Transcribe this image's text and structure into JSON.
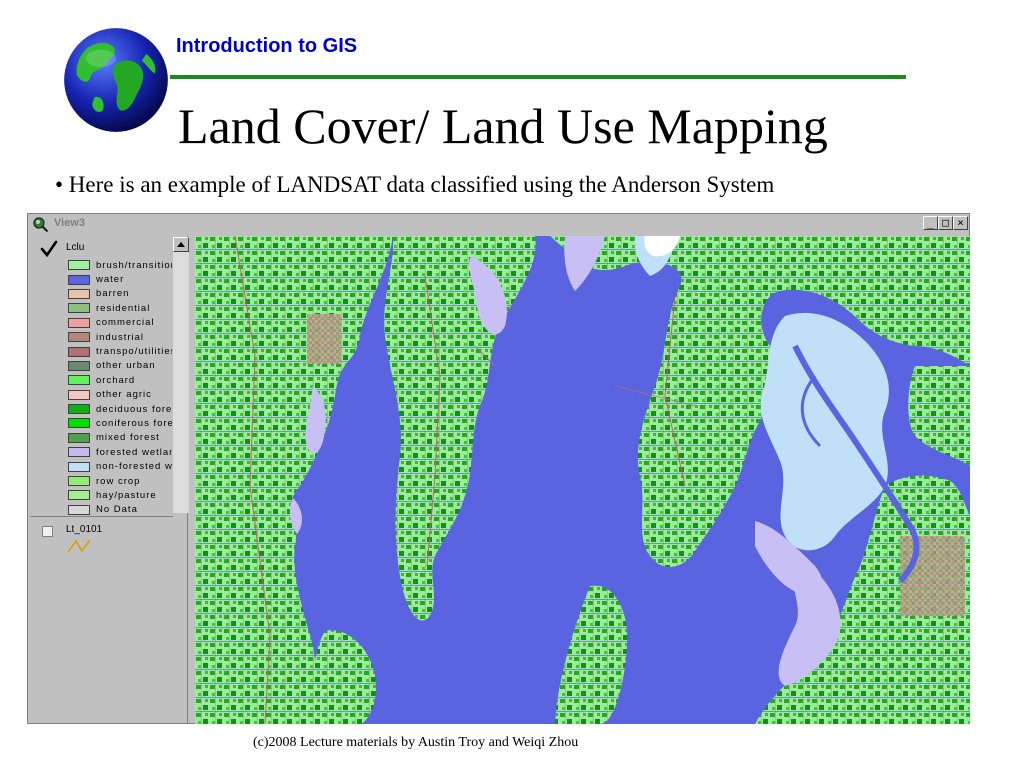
{
  "slide": {
    "course": "Introduction to GIS",
    "title": "Land Cover/ Land Use Mapping",
    "bullet": "• Here is an example of LANDSAT data classified using the Anderson System",
    "footer": "(c)2008 Lecture materials by Austin Troy and Weiqi Zhou"
  },
  "window": {
    "title": "View3",
    "buttons": {
      "minimize": "_",
      "maximize": "□",
      "close": "×"
    }
  },
  "toc": {
    "theme1": {
      "name": "Lclu",
      "items": [
        {
          "label": "brush/transitional",
          "color": "#a0f0a0"
        },
        {
          "label": "water",
          "color": "#5a63e0"
        },
        {
          "label": "barren",
          "color": "#e8c3ab"
        },
        {
          "label": "residential",
          "color": "#8fbf7f"
        },
        {
          "label": "commercial",
          "color": "#f0a0a0"
        },
        {
          "label": "industrial",
          "color": "#b08878"
        },
        {
          "label": "transpo/utilities",
          "color": "#b07070"
        },
        {
          "label": "other urban",
          "color": "#6a8a70"
        },
        {
          "label": "orchard",
          "color": "#60f060"
        },
        {
          "label": "other agric",
          "color": "#f4c8c0"
        },
        {
          "label": "deciduous forest",
          "color": "#10b010"
        },
        {
          "label": "coniferous forest",
          "color": "#00e000"
        },
        {
          "label": "mixed forest",
          "color": "#50a050"
        },
        {
          "label": "forested wetland",
          "color": "#c8b8f0"
        },
        {
          "label": "non-forested wetland",
          "color": "#c0e0f8"
        },
        {
          "label": "row crop",
          "color": "#90ee70"
        },
        {
          "label": "hay/pasture",
          "color": "#a0f090"
        },
        {
          "label": "No Data",
          "color": "#d8d8d8"
        }
      ]
    },
    "theme2": {
      "name": "Lt_0101"
    }
  },
  "colors": {
    "title_bar_green": "#1a8a1a",
    "course_blue": "#0000cc",
    "map_water": "#5a63e0",
    "map_land": "#9aec9a",
    "map_forest": "#1faa1f",
    "map_wetland": "#c8c0f4",
    "map_urban": "#b48a80"
  }
}
